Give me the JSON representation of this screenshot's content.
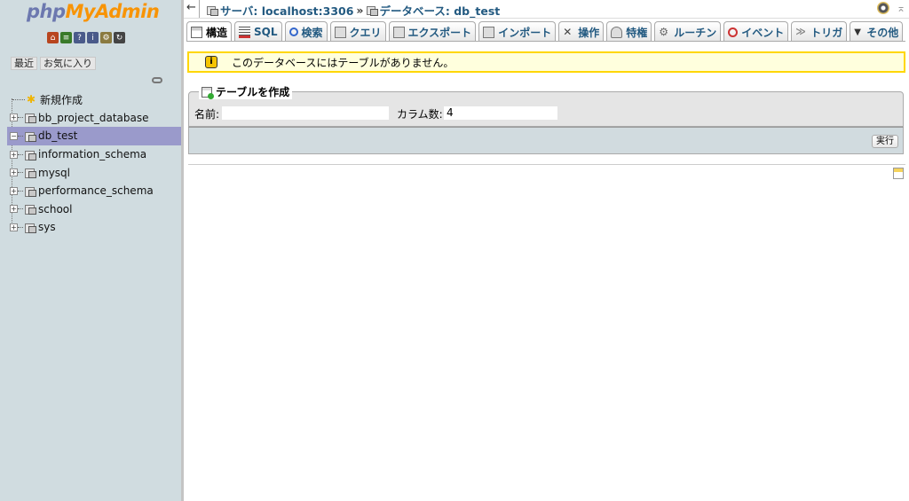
{
  "app": {
    "logo_part1": "php",
    "logo_part2": "MyAdmin"
  },
  "sidebar": {
    "quick_icons": [
      "home-icon",
      "sql-icon",
      "docs-icon",
      "help-icon",
      "settings-icon",
      "reload-icon"
    ],
    "recent_tab": "最近",
    "favorites_tab": "お気に入り",
    "new_label": "新規作成",
    "databases": [
      {
        "name": "bb_project_database",
        "selected": false
      },
      {
        "name": "db_test",
        "selected": true
      },
      {
        "name": "information_schema",
        "selected": false
      },
      {
        "name": "mysql",
        "selected": false
      },
      {
        "name": "performance_schema",
        "selected": false
      },
      {
        "name": "school",
        "selected": false
      },
      {
        "name": "sys",
        "selected": false
      }
    ]
  },
  "breadcrumb": {
    "server": "サーバ: localhost:3306",
    "separator": "»",
    "database": "データベース: db_test"
  },
  "tabs": [
    {
      "label": "構造",
      "icon": "structure-icon",
      "active": true
    },
    {
      "label": "SQL",
      "icon": "sql-icon",
      "active": false
    },
    {
      "label": "検索",
      "icon": "search-icon",
      "active": false
    },
    {
      "label": "クエリ",
      "icon": "query-icon",
      "active": false
    },
    {
      "label": "エクスポート",
      "icon": "export-icon",
      "active": false
    },
    {
      "label": "インポート",
      "icon": "import-icon",
      "active": false
    },
    {
      "label": "操作",
      "icon": "operations-icon",
      "active": false
    },
    {
      "label": "特権",
      "icon": "privileges-icon",
      "active": false
    },
    {
      "label": "ルーチン",
      "icon": "routines-icon",
      "active": false
    },
    {
      "label": "イベント",
      "icon": "events-icon",
      "active": false
    },
    {
      "label": "トリガ",
      "icon": "triggers-icon",
      "active": false
    },
    {
      "label": "その他",
      "icon": "more-icon",
      "active": false
    }
  ],
  "notice": {
    "text": "このデータベースにはテーブルがありません。"
  },
  "create_table": {
    "legend": "テーブルを作成",
    "name_label": "名前:",
    "name_value": "",
    "columns_label": "カラム数:",
    "columns_value": "4",
    "go_label": "実行"
  },
  "colors": {
    "sidebar_bg": "#d0dce0",
    "selected_row": "#9a9acb",
    "link": "#235a81",
    "notice_bg": "#ffffdd",
    "notice_border": "#ffd700"
  }
}
